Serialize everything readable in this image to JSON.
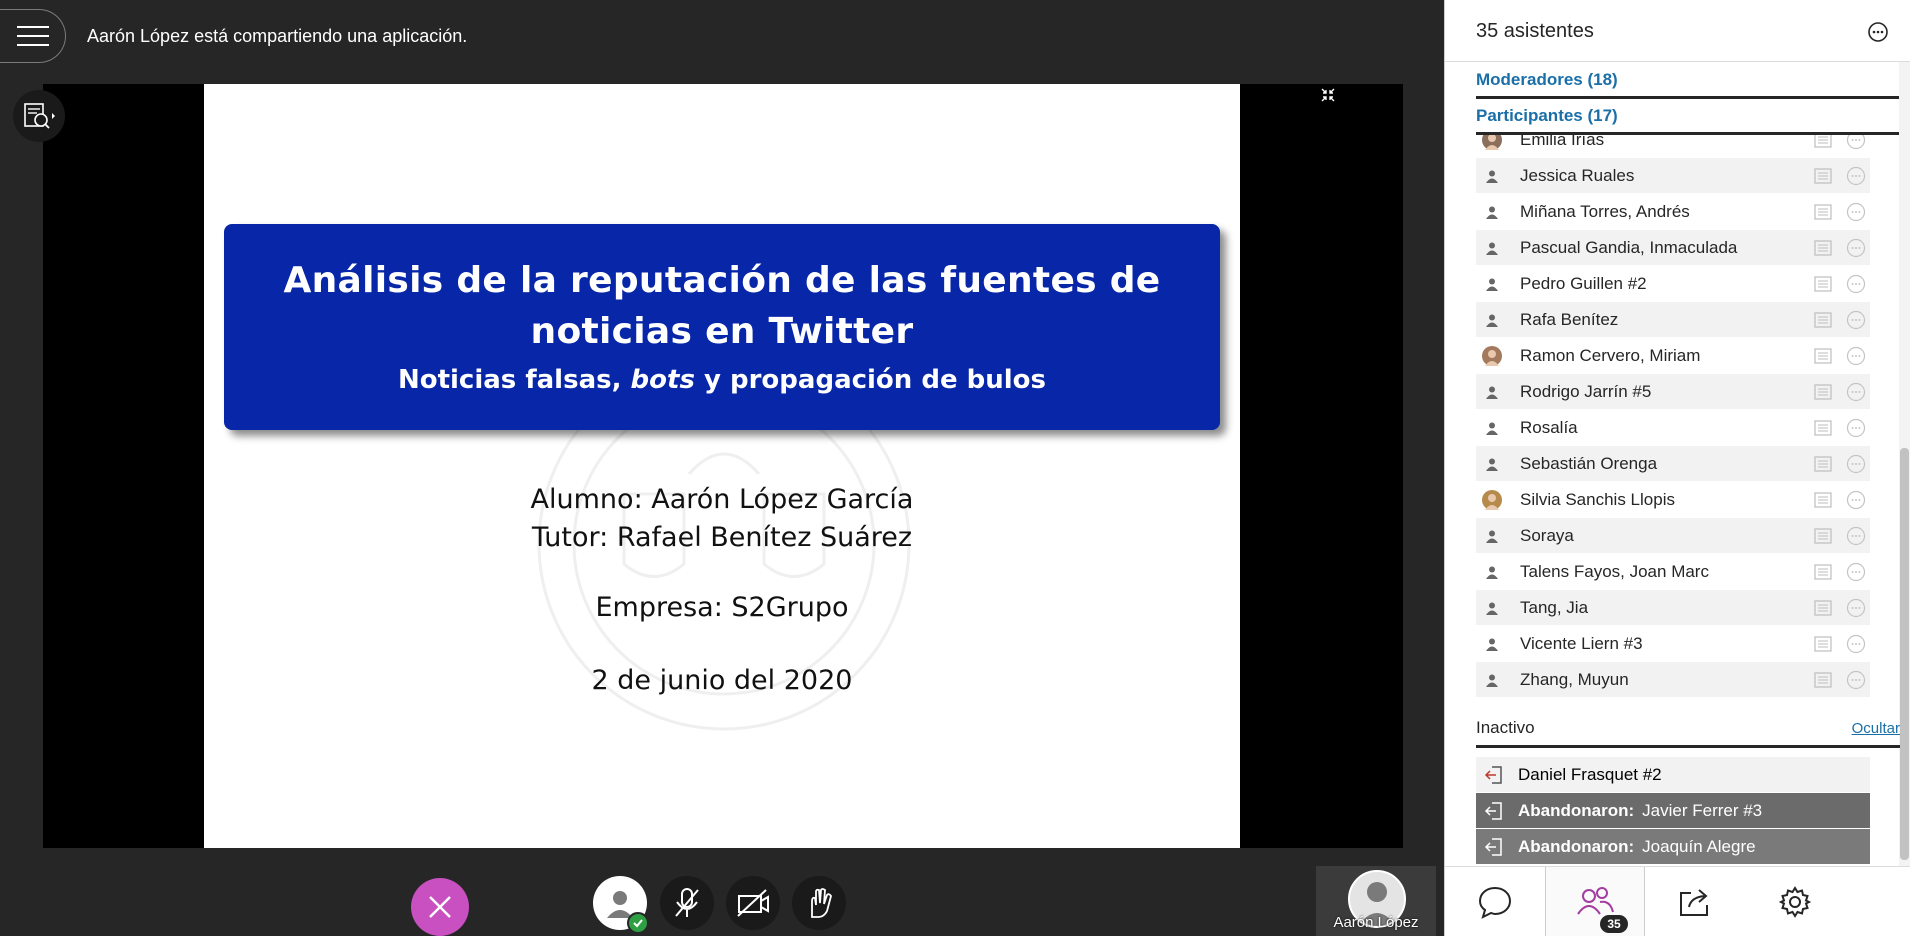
{
  "session": {
    "share_status": "Aarón López está compartiendo una aplicación.",
    "presenter_name": "Aarón López"
  },
  "slide": {
    "title_line1": "Análisis de la reputación de las fuentes de",
    "title_line2": "noticias en Twitter",
    "subtitle_before": "Noticias falsas,",
    "subtitle_emph": "bots",
    "subtitle_after": "y propagación de bulos",
    "student": "Alumno: Aarón López García",
    "tutor": "Tutor: Rafael Benítez Suárez",
    "company": "Empresa: S2Grupo",
    "date": "2 de junio del 2020"
  },
  "panel": {
    "title": "35 asistentes",
    "moderators_label": "Moderadores (18)",
    "participants_label": "Participantes (17)",
    "participants": [
      {
        "name": "Emilia Irías",
        "avatar": "photo"
      },
      {
        "name": "Jessica Ruales",
        "avatar": "person"
      },
      {
        "name": "Miñana Torres, Andrés",
        "avatar": "person"
      },
      {
        "name": "Pascual Gandia, Inmaculada",
        "avatar": "person"
      },
      {
        "name": "Pedro Guillen #2",
        "avatar": "person"
      },
      {
        "name": "Rafa Benítez",
        "avatar": "person"
      },
      {
        "name": "Ramon Cervero, Miriam",
        "avatar": "photo"
      },
      {
        "name": "Rodrigo Jarrín #5",
        "avatar": "person"
      },
      {
        "name": "Rosalía",
        "avatar": "person"
      },
      {
        "name": "Sebastián Orenga",
        "avatar": "person"
      },
      {
        "name": "Silvia Sanchis Llopis",
        "avatar": "photo"
      },
      {
        "name": "Soraya",
        "avatar": "person"
      },
      {
        "name": "Talens Fayos, Joan Marc",
        "avatar": "person"
      },
      {
        "name": "Tang, Jia",
        "avatar": "person"
      },
      {
        "name": "Vicente Liern #3",
        "avatar": "person"
      },
      {
        "name": "Zhang, Muyun",
        "avatar": "person"
      }
    ],
    "inactive_label": "Inactivo",
    "hide_label": "Ocultar",
    "inactive": [
      {
        "prefix": "",
        "name": "Daniel Frasquet #2"
      },
      {
        "prefix": "Abandonaron:",
        "name": "Javier Ferrer #3"
      },
      {
        "prefix": "Abandonaron:",
        "name": "Joaquín Alegre"
      }
    ],
    "attendee_badge": "35"
  },
  "colors": {
    "accent": "#1b6fa8",
    "slide_title_bg": "#0726a8",
    "close_fab": "#c850c0",
    "status_ok": "#2ea043"
  }
}
